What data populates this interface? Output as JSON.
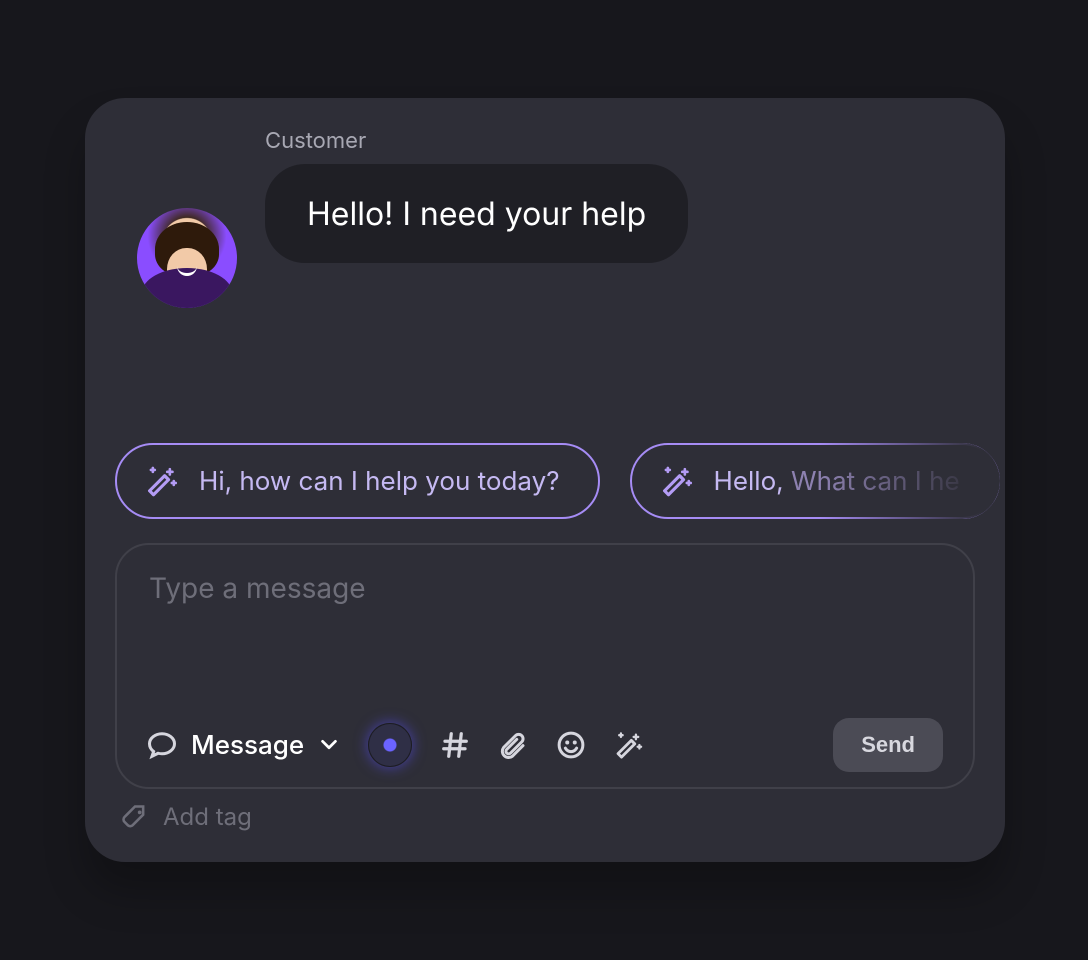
{
  "message": {
    "sender_label": "Customer",
    "text": "Hello! I need your help"
  },
  "suggestions": [
    {
      "text": "Hi, how can I help you today?"
    },
    {
      "prefix": "Hello, ",
      "extra": "What can I he"
    }
  ],
  "composer": {
    "placeholder": "Type a message",
    "msg_type_label": "Message",
    "send_label": "Send"
  },
  "add_tag_label": "Add tag",
  "icons": {
    "wand": "magic-wand-icon",
    "chat": "chat-bubble-icon",
    "chevron": "chevron-down-icon",
    "hash": "hash-icon",
    "clip": "paperclip-icon",
    "emoji": "emoji-icon",
    "tag": "tag-icon",
    "voice": "voice-icon"
  },
  "colors": {
    "accent": "#a68cf5",
    "panel": "#2e2e37",
    "bg": "#17171c",
    "bubble": "#1f1f25"
  }
}
